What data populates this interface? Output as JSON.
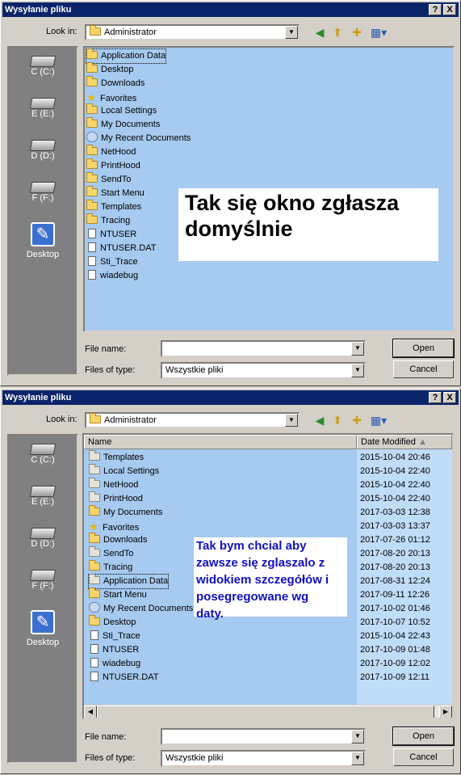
{
  "dialog1": {
    "title": "Wysyłanie pliku",
    "help_btn": "?",
    "close_btn": "X",
    "lookin_label": "Look in:",
    "lookin_value": "Administrator",
    "places": [
      "C (C:)",
      "E (E:)",
      "D (D:)",
      "F (F:)",
      "Desktop"
    ],
    "files": [
      {
        "name": "Application Data",
        "icon": "folder-icon"
      },
      {
        "name": "Desktop",
        "icon": "folder-icon"
      },
      {
        "name": "Downloads",
        "icon": "folder-icon"
      },
      {
        "name": "Favorites",
        "icon": "star-icon"
      },
      {
        "name": "Local Settings",
        "icon": "folder-icon"
      },
      {
        "name": "My Documents",
        "icon": "folder-icon"
      },
      {
        "name": "My Recent Documents",
        "icon": "recent-icon"
      },
      {
        "name": "NetHood",
        "icon": "folder-icon"
      },
      {
        "name": "PrintHood",
        "icon": "folder-icon"
      },
      {
        "name": "SendTo",
        "icon": "folder-icon"
      },
      {
        "name": "Start Menu",
        "icon": "folder-icon"
      },
      {
        "name": "Templates",
        "icon": "folder-icon"
      },
      {
        "name": "Tracing",
        "icon": "folder-icon"
      },
      {
        "name": "NTUSER",
        "icon": "document-icon"
      },
      {
        "name": "NTUSER.DAT",
        "icon": "document-icon"
      },
      {
        "name": "Sti_Trace",
        "icon": "document-icon"
      },
      {
        "name": "wiadebug",
        "icon": "document-icon"
      }
    ],
    "annotation": "Tak się okno zgłasza\ndomyślnie",
    "filename_label": "File name:",
    "filename_value": "",
    "filetype_label": "Files of type:",
    "filetype_value": "Wszystkie pliki",
    "open_btn": "Open",
    "cancel_btn": "Cancel"
  },
  "dialog2": {
    "title": "Wysyłanie pliku",
    "help_btn": "?",
    "close_btn": "X",
    "lookin_label": "Look in:",
    "lookin_value": "Administrator",
    "places": [
      "C (C:)",
      "E (E:)",
      "D (D:)",
      "F (F:)",
      "Desktop"
    ],
    "columns": {
      "name": "Name",
      "date": "Date Modified"
    },
    "rows": [
      {
        "name": "Templates",
        "date": "2015-10-04 20:46",
        "icon": "folder-icon"
      },
      {
        "name": "Local Settings",
        "date": "2015-10-04 22:40",
        "icon": "folder-icon"
      },
      {
        "name": "NetHood",
        "date": "2015-10-04 22:40",
        "icon": "folder-icon"
      },
      {
        "name": "PrintHood",
        "date": "2015-10-04 22:40",
        "icon": "folder-icon"
      },
      {
        "name": "My Documents",
        "date": "2017-03-03 12:38",
        "icon": "folder-icon"
      },
      {
        "name": "Favorites",
        "date": "2017-03-03 13:37",
        "icon": "star-icon"
      },
      {
        "name": "Downloads",
        "date": "2017-07-26 01:12",
        "icon": "folder-icon"
      },
      {
        "name": "SendTo",
        "date": "2017-08-20 20:13",
        "icon": "folder-icon"
      },
      {
        "name": "Tracing",
        "date": "2017-08-20 20:13",
        "icon": "folder-icon"
      },
      {
        "name": "Application Data",
        "date": "2017-08-31 12:24",
        "icon": "folder-icon"
      },
      {
        "name": "Start Menu",
        "date": "2017-09-11 12:26",
        "icon": "folder-icon"
      },
      {
        "name": "My Recent Documents",
        "date": "2017-10-02 01:46",
        "icon": "recent-icon"
      },
      {
        "name": "Desktop",
        "date": "2017-10-07 10:52",
        "icon": "folder-icon"
      },
      {
        "name": "Sti_Trace",
        "date": "2015-10-04 22:43",
        "icon": "document-icon"
      },
      {
        "name": "NTUSER",
        "date": "2017-10-09 01:48",
        "icon": "document-icon"
      },
      {
        "name": "wiadebug",
        "date": "2017-10-09 12:02",
        "icon": "document-icon"
      },
      {
        "name": "NTUSER.DAT",
        "date": "2017-10-09 12:11",
        "icon": "document-icon"
      }
    ],
    "annotation": "Tak bym chcial aby\nzawsze się zglaszalo z\nwidokiem szczegółów i\nposegregowane wg\ndaty.",
    "filename_label": "File name:",
    "filename_value": "",
    "filetype_label": "Files of type:",
    "filetype_value": "Wszystkie pliki",
    "open_btn": "Open",
    "cancel_btn": "Cancel"
  }
}
